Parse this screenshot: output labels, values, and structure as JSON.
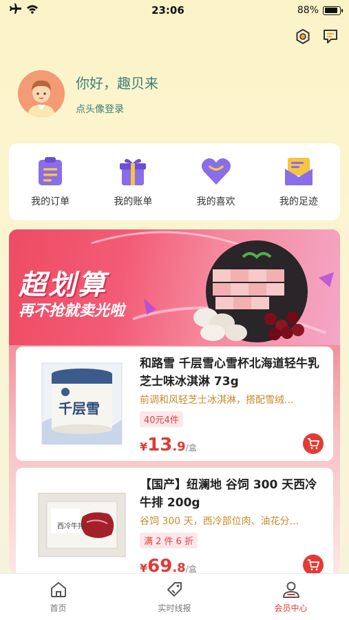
{
  "status_bar": {
    "time": "23:06",
    "battery": "88%",
    "battery_level": 0.88
  },
  "profile": {
    "greeting": "你好，趣贝来",
    "login_hint": "点头像登录"
  },
  "quick_actions": [
    {
      "label": "我的订单",
      "icon": "order-clipboard-icon"
    },
    {
      "label": "我的账单",
      "icon": "gift-box-icon"
    },
    {
      "label": "我的喜欢",
      "icon": "heart-icon"
    },
    {
      "label": "我的足迹",
      "icon": "envelope-icon"
    }
  ],
  "banner": {
    "title": "超划算",
    "subtitle": "再不抢就卖光啦"
  },
  "products": [
    {
      "name": "和路雪 千层雪心雪杯北海道轻牛乳芝士味冰淇淋 73g",
      "desc": "前调和风轻芝士冰淇淋，搭配雪绒...",
      "tag": "40元4件",
      "currency": "¥",
      "price_int": "13",
      "price_dec": ".9",
      "unit": "/盒",
      "pic_label": "千层雪"
    },
    {
      "name": "【国产】纽澜地 谷饲 300 天西冷牛排 200g",
      "desc": "谷饲 300 天，西冷部位肉、油花分...",
      "tag": "满 2 件 6 折",
      "currency": "¥",
      "price_int": "69",
      "price_dec": ".8",
      "unit": "/盒",
      "pic_label": "西冷牛排"
    }
  ],
  "tabs": [
    {
      "label": "首页",
      "icon": "home-icon",
      "active": false
    },
    {
      "label": "实时线报",
      "icon": "tag-icon",
      "active": false
    },
    {
      "label": "会员中心",
      "icon": "user-icon",
      "active": true
    }
  ],
  "colors": {
    "accent": "#e53a34",
    "teal": "#3d7f7c",
    "purple": "#8a6de8"
  }
}
